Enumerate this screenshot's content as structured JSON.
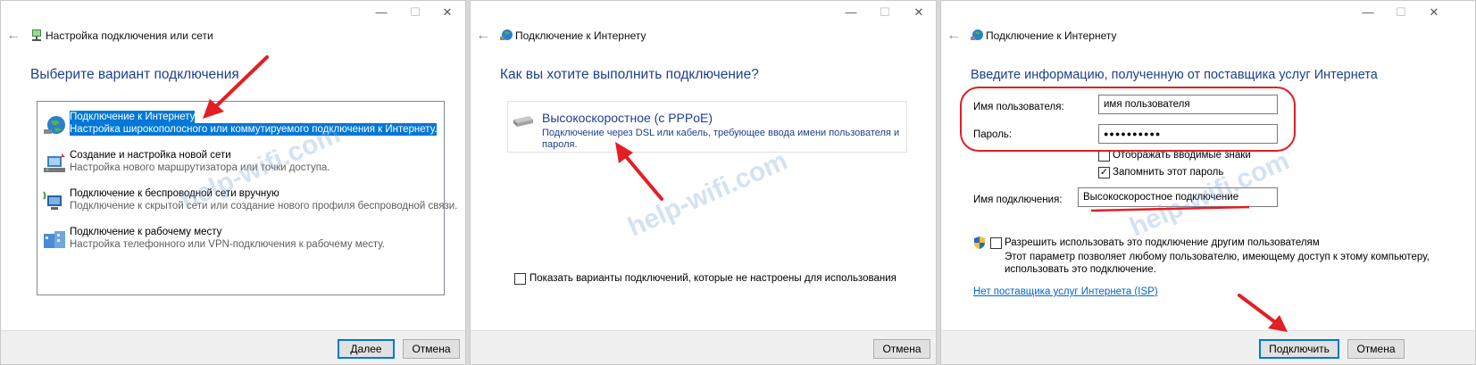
{
  "window_controls": {
    "minimize": "—",
    "maximize": "☐",
    "close": "✕"
  },
  "panel1": {
    "back_glyph": "←",
    "title": "Настройка подключения или сети",
    "heading": "Выберите вариант подключения",
    "options": [
      {
        "title": "Подключение к Интернету",
        "desc": "Настройка широкополосного или коммутируемого подключения к Интернету."
      },
      {
        "title": "Создание и настройка новой сети",
        "desc": "Настройка нового маршрутизатора или точки доступа."
      },
      {
        "title": "Подключение к беспроводной сети вручную",
        "desc": "Подключение к скрытой сети или создание нового профиля беспроводной связи."
      },
      {
        "title": "Подключение к рабочему месту",
        "desc": "Настройка телефонного или VPN-подключения к рабочему месту."
      }
    ],
    "next_button": "Далее",
    "cancel_button": "Отмена",
    "watermark": "help-wifi.com"
  },
  "panel2": {
    "back_glyph": "←",
    "title": "Подключение к Интернету",
    "heading": "Как вы хотите выполнить подключение?",
    "option": {
      "title": "Высокоскоростное (с PPPoE)",
      "desc_line1": "Подключение через DSL или кабель, требующее ввода имени пользователя и",
      "desc_line2": "пароля."
    },
    "show_all_checkbox": {
      "label": "Показать варианты подключений, которые не настроены для использования",
      "checked": false
    },
    "cancel_button": "Отмена",
    "watermark": "help-wifi.com"
  },
  "panel3": {
    "back_glyph": "←",
    "title": "Подключение к Интернету",
    "heading": "Введите информацию, полученную от поставщика услуг Интернета",
    "username_label": "Имя пользователя:",
    "username_value": "имя пользователя",
    "password_label": "Пароль:",
    "password_value": "●●●●●●●●●●",
    "show_chars_checkbox": {
      "label": "Отображать вводимые знаки",
      "checked": false
    },
    "remember_checkbox": {
      "label": "Запомнить этот пароль",
      "checked": true
    },
    "connection_name_label": "Имя подключения:",
    "connection_name_value": "Высокоскоростное подключение",
    "allow_others_checkbox": {
      "label": "Разрешить использовать это подключение другим пользователям",
      "checked": false
    },
    "allow_desc_line1": "Этот параметр позволяет любому пользователю, имеющему доступ к этому компьютеру,",
    "allow_desc_line2": "использовать это подключение.",
    "no_isp_link": "Нет поставщика услуг Интернета (ISP)",
    "connect_button": "Подключить",
    "cancel_button": "Отмена",
    "watermark": "help-wifi.com"
  },
  "colors": {
    "accent": "#0078d7",
    "heading": "#1e3f8c",
    "annotation": "#e31e24"
  },
  "checkmark_glyph": "✓"
}
